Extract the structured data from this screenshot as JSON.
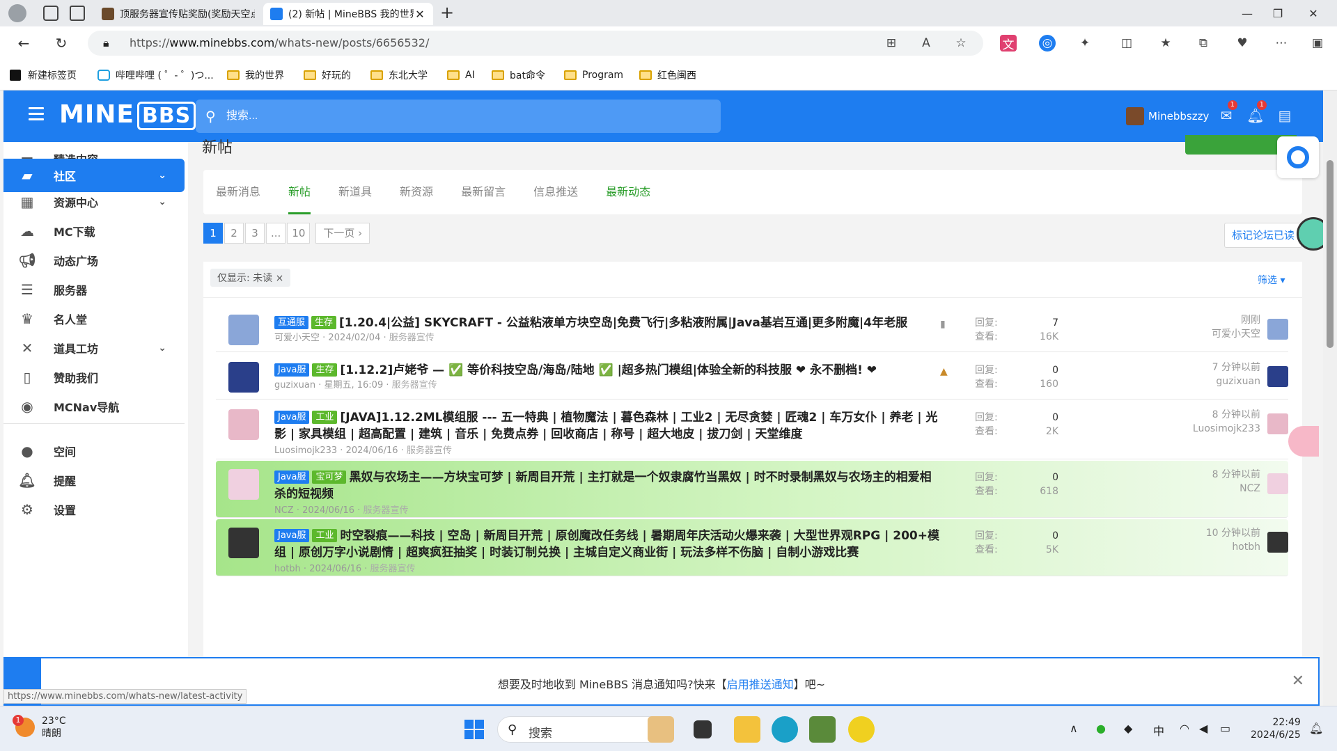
{
  "browser": {
    "tabs": [
      {
        "title": "顶服务器宣传贴奖励(奖励天空点",
        "active": false
      },
      {
        "title": "(2) 新帖 | MineBBS 我的世界中文",
        "active": true
      }
    ],
    "new_tab": "+",
    "url_prefix": "https://",
    "url_host": "www.minebbs.com",
    "url_path": "/whats-new/posts/6656532/",
    "bookmarks": [
      "新建标签页",
      "哔哩哔哩 ( ゜- ゜)つ...",
      "我的世界",
      "好玩的",
      "东北大学",
      "AI",
      "bat命令",
      "Program",
      "红色闽西"
    ]
  },
  "header": {
    "logo_mine": "MINE",
    "logo_bbs": "BBS",
    "search_placeholder": "搜索...",
    "username": "Minebbszzy",
    "mail_badge": "1",
    "alert_badge": "1"
  },
  "sidebar": {
    "items": [
      {
        "label": "精选内容",
        "icon": "folder-icon",
        "expand": false
      },
      {
        "label": "社区",
        "icon": "chat-icon",
        "expand": true,
        "active": true
      },
      {
        "label": "资源中心",
        "icon": "resources-icon",
        "expand": true
      },
      {
        "label": "MC下载",
        "icon": "cloud-download-icon",
        "expand": false
      },
      {
        "label": "动态广场",
        "icon": "megaphone-icon",
        "expand": false
      },
      {
        "label": "服务器",
        "icon": "server-icon",
        "expand": false
      },
      {
        "label": "名人堂",
        "icon": "trophy-icon",
        "expand": false
      },
      {
        "label": "道具工坊",
        "icon": "tools-icon",
        "expand": true
      },
      {
        "label": "赞助我们",
        "icon": "donate-icon",
        "expand": false
      },
      {
        "label": "MCNav导航",
        "icon": "compass-icon",
        "expand": false
      }
    ],
    "user_items": [
      {
        "label": "空间",
        "icon": "user-icon"
      },
      {
        "label": "提醒",
        "icon": "bell-icon"
      },
      {
        "label": "设置",
        "icon": "gear-icon"
      }
    ]
  },
  "main": {
    "title": "新帖",
    "tabs": [
      "最新消息",
      "新帖",
      "新道具",
      "新资源",
      "最新留言",
      "信息推送",
      "最新动态"
    ],
    "active_tab": 1,
    "pages": [
      "1",
      "2",
      "3",
      "...",
      "10"
    ],
    "next": "下一页 ›",
    "mark_read": "标记论坛已读",
    "filter_prefix": "仅显示:",
    "filter_value": "未读 ×",
    "filter_link": "筛选 ▾",
    "reply_label": "回复:",
    "view_label": "查看:",
    "threads": [
      {
        "tags": [
          "互通服",
          "生存"
        ],
        "title": "[1.20.4|公益] SKYCRAFT - 公益粘液单方块空岛|免费飞行|多粘液附属|Java基岩互通|更多附魔|4年老服",
        "author": "可爱小天空",
        "date": "2024/02/04",
        "forum": "服务器宣传",
        "replies": "7",
        "views": "16K",
        "last_time": "刚刚",
        "last_user": "可爱小天空",
        "highlight": false,
        "avatar": "#8aa6d8"
      },
      {
        "tags": [
          "Java服",
          "生存"
        ],
        "title": "[1.12.2]卢姥爷 — ✅ 等价科技空岛/海岛/陆地 ✅ |超多热门模组|体验全新的科技服 ❤ 永不删档! ❤",
        "author": "guzixuan",
        "date": "星期五, 16:09",
        "forum": "服务器宣传",
        "replies": "0",
        "views": "160",
        "last_time": "7 分钟以前",
        "last_user": "guzixuan",
        "highlight": false,
        "avatar": "#2a3f8a"
      },
      {
        "tags": [
          "Java服",
          "工业"
        ],
        "title": "[JAVA]1.12.2ML模组服 --- 五一特典 | 植物魔法 | 暮色森林 | 工业2 | 无尽贪婪 | 匠魂2 | 车万女仆 | 养老 | 光影 | 家具模组 | 超高配置 | 建筑 | 音乐 | 免费点券 | 回收商店 | 称号 | 超大地皮 | 拔刀剑 | 天堂维度",
        "author": "Luosimojk233",
        "date": "2024/06/16",
        "forum": "服务器宣传",
        "replies": "0",
        "views": "2K",
        "last_time": "8 分钟以前",
        "last_user": "Luosimojk233",
        "highlight": false,
        "avatar": "#e8b8c8"
      },
      {
        "tags": [
          "Java服",
          "宝可梦"
        ],
        "title": "黑奴与农场主——方块宝可梦 | 新周目开荒 | 主打就是一个奴隶腐竹当黑奴 | 时不时录制黑奴与农场主的相爱相杀的短视频",
        "author": "NCZ",
        "date": "2024/06/16",
        "forum": "服务器宣传",
        "replies": "0",
        "views": "618",
        "last_time": "8 分钟以前",
        "last_user": "NCZ",
        "highlight": true,
        "avatar": "#f0d0e0"
      },
      {
        "tags": [
          "Java服",
          "工业"
        ],
        "title": "时空裂痕——科技 | 空岛 | 新周目开荒 | 原创魔改任务线 | 暑期周年庆活动火爆来袭 | 大型世界观RPG | 200+模组 | 原创万字小说剧情 | 超爽疯狂抽奖 | 时装订制兑换 | 主城自定义商业街 | 玩法多样不伤脑 | 自制小游戏比赛",
        "author": "hotbh",
        "date": "2024/06/16",
        "forum": "服务器宣传",
        "replies": "0",
        "views": "5K",
        "last_time": "10 分钟以前",
        "last_user": "hotbh",
        "highlight": true,
        "avatar": "#333333"
      }
    ]
  },
  "notice": {
    "pre": "想要及时地收到 MineBBS 消息通知吗?快来【",
    "link": "启用推送通知",
    "post": "】吧~"
  },
  "status_url": "https://www.minebbs.com/whats-new/latest-activity",
  "taskbar": {
    "temp": "23°C",
    "weather": "晴朗",
    "weather_badge": "1",
    "search": "搜索",
    "ime": "中",
    "time": "22:49",
    "date": "2024/6/25"
  },
  "colors": {
    "brand": "#1e7df0",
    "accent_green": "#2a9d2a",
    "tag_green": "#5cb82c"
  }
}
